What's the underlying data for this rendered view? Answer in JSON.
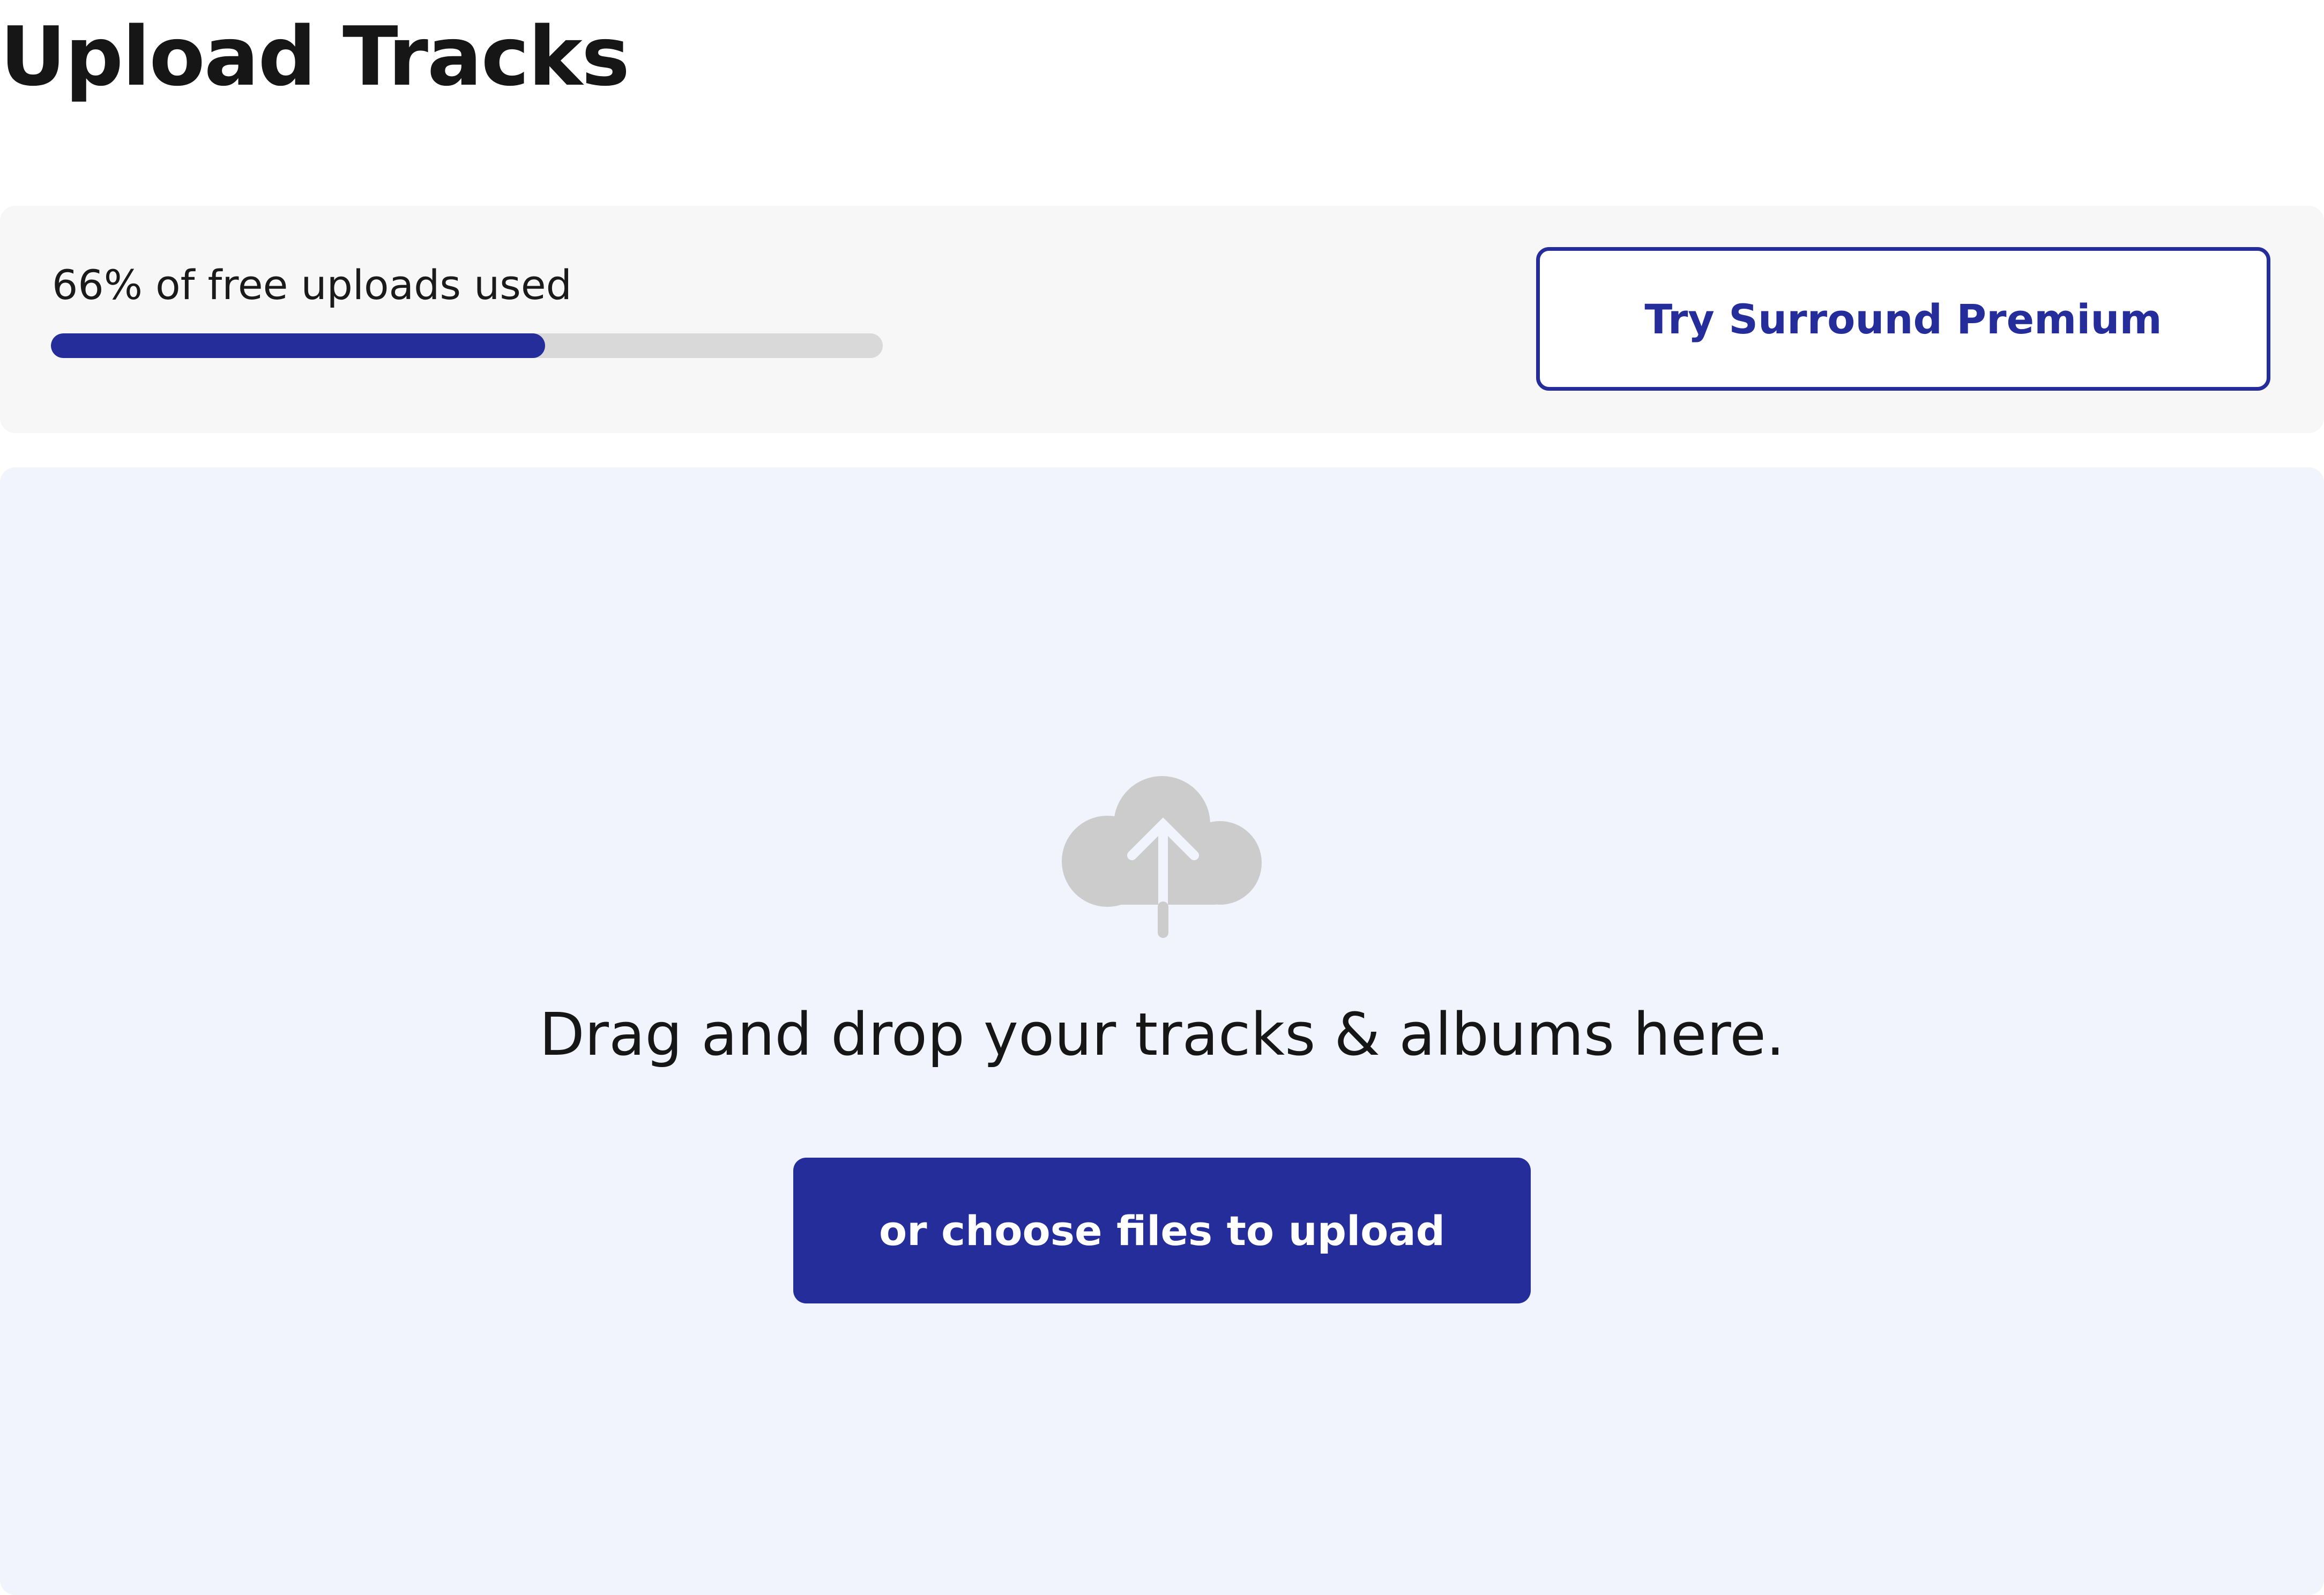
{
  "page": {
    "title": "Upload Tracks"
  },
  "quota": {
    "label": "66% of free uploads used",
    "progress_fraction": 0.594,
    "fill_color": "#252d9a",
    "track_color": "#d9d9d9"
  },
  "premium": {
    "button_label": "Try Surround Premium"
  },
  "dropzone": {
    "icon": "cloud-upload-icon",
    "message": "Drag and drop your tracks & albums here.",
    "choose_button_label": "or choose files to upload",
    "background_color": "#f1f4fd"
  },
  "colors": {
    "accent": "#252d9a",
    "text": "#161616",
    "icon_gray": "#cccccc"
  }
}
